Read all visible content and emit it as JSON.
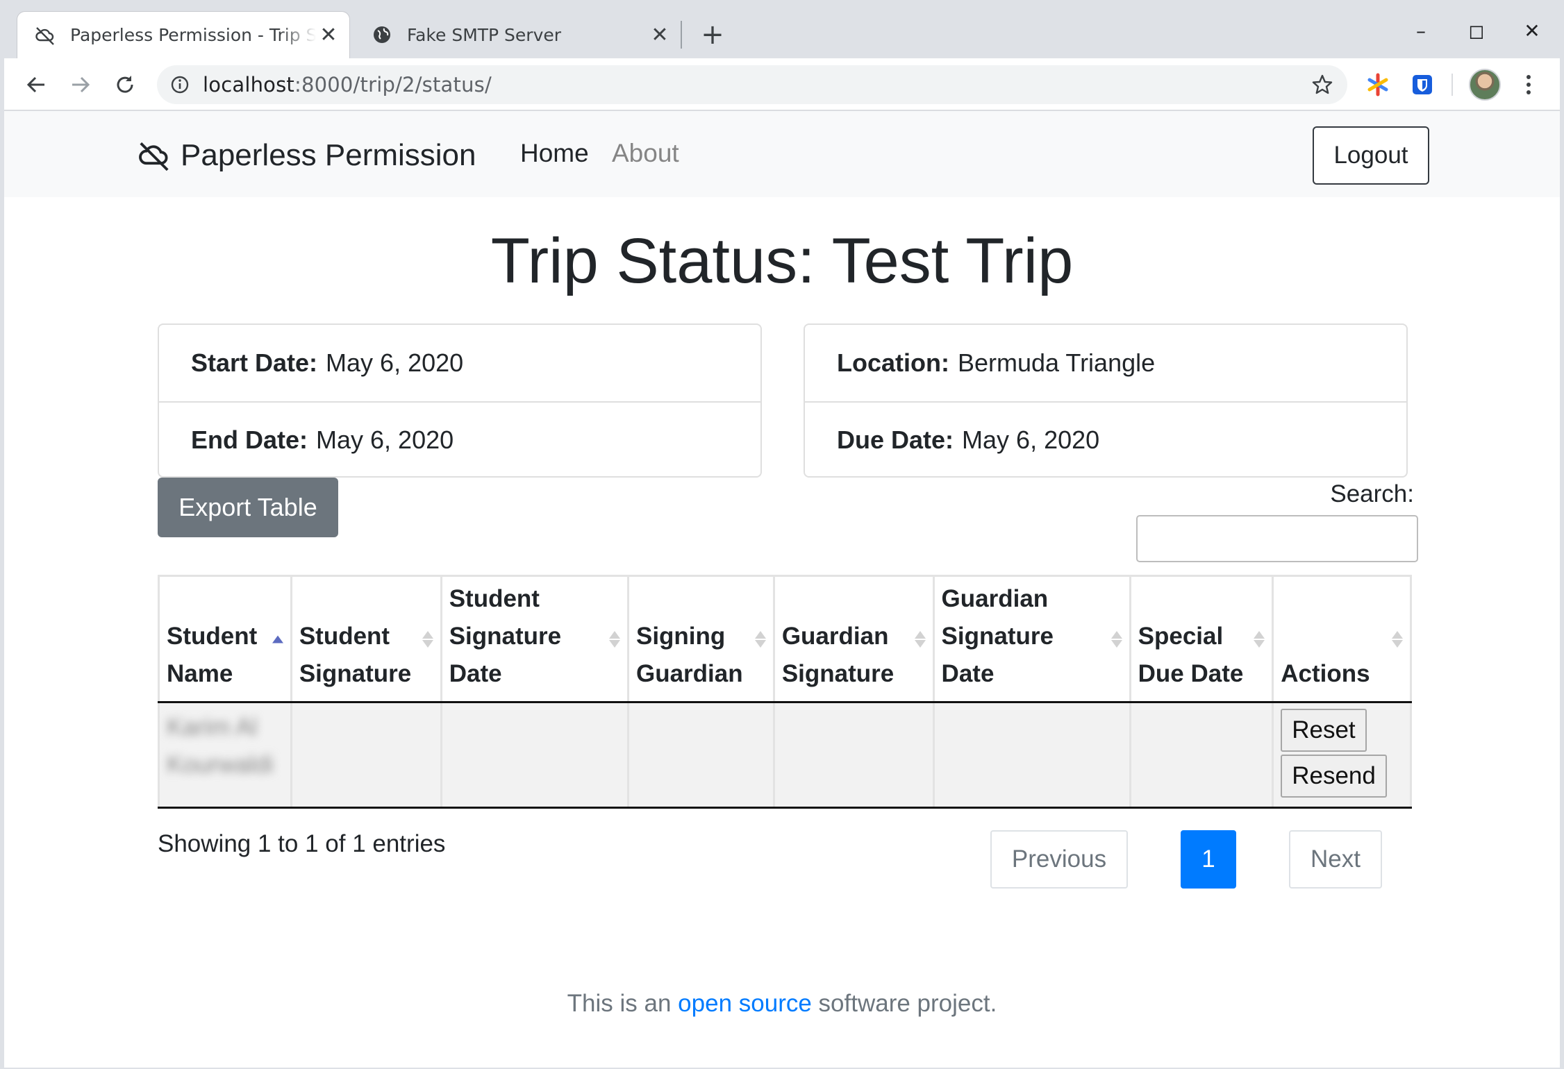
{
  "browser": {
    "tabs": [
      {
        "title": "Paperless Permission - Trip Status",
        "icon": "crossed-cloud-icon",
        "active": true
      },
      {
        "title": "Fake SMTP Server",
        "icon": "globe-icon",
        "active": false
      }
    ],
    "new_tab": "+",
    "window_controls": {
      "minimize": "–",
      "maximize": "◻",
      "close": "✕"
    },
    "url_host": "localhost",
    "url_rest": ":8000/trip/2/status/"
  },
  "nav": {
    "brand": "Paperless Permission",
    "links": [
      "Home",
      "About"
    ],
    "logout": "Logout"
  },
  "page": {
    "title": "Trip Status: Test Trip",
    "details_left": [
      {
        "label": "Start Date:",
        "value": "May 6, 2020"
      },
      {
        "label": "End Date:",
        "value": "May 6, 2020"
      }
    ],
    "details_right": [
      {
        "label": "Location:",
        "value": "Bermuda Triangle"
      },
      {
        "label": "Due Date:",
        "value": "May 6, 2020"
      }
    ],
    "export_button": "Export Table",
    "search_label": "Search:",
    "search_value": ""
  },
  "table": {
    "columns": [
      "Student Name",
      "Student Signature",
      "Student Signature Date",
      "Signing Guardian",
      "Guardian Signature",
      "Guardian Signature Date",
      "Special Due Date",
      "Actions"
    ],
    "sorted_column": "Student Name",
    "rows": [
      {
        "student_name": "Karim Al Kourwaldi",
        "student_signature": "",
        "student_signature_date": "",
        "signing_guardian": "",
        "guardian_signature": "",
        "guardian_signature_date": "",
        "special_due_date": "",
        "actions": [
          "Reset",
          "Resend"
        ]
      }
    ],
    "info": "Showing 1 to 1 of 1 entries",
    "pagination": {
      "previous": "Previous",
      "current": "1",
      "next": "Next"
    }
  },
  "footer": {
    "prefix": "This is an ",
    "link": "open source",
    "suffix": " software project."
  }
}
